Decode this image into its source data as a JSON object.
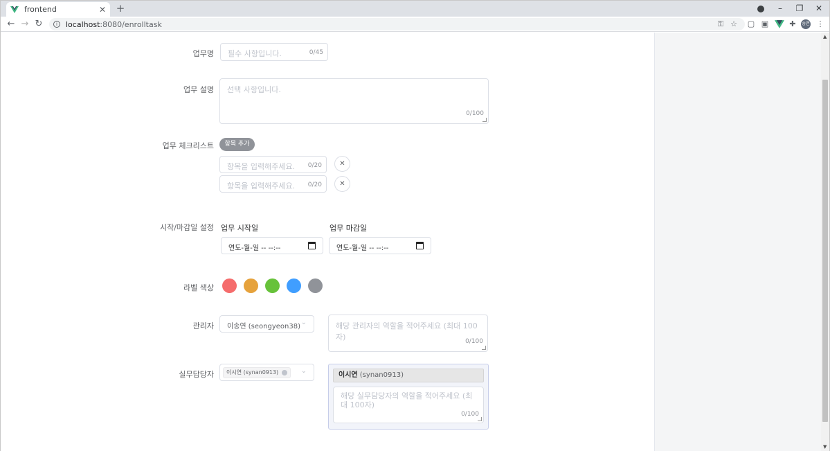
{
  "browser": {
    "tab_title": "frontend",
    "url_host": "localhost",
    "url_rest": ":8080/enrolltask",
    "avatar_text": "송연"
  },
  "form": {
    "task_name": {
      "label": "업무명",
      "placeholder": "필수 사항입니다.",
      "count": "0/45"
    },
    "task_desc": {
      "label": "업무 설명",
      "placeholder": "선택 사항입니다.",
      "count": "0/100"
    },
    "checklist": {
      "label": "업무 체크리스트",
      "add_button": "항목 추가",
      "items": [
        {
          "placeholder": "항목을 입력해주세요.",
          "count": "0/20"
        },
        {
          "placeholder": "항목을 입력해주세요.",
          "count": "0/20"
        }
      ]
    },
    "dates": {
      "label": "시작/마감일 설정",
      "start_label": "업무 시작일",
      "end_label": "업무 마감일",
      "start_value": "연도-월-일 -- --:--",
      "end_value": "연도-월-일 -- --:--"
    },
    "colors": {
      "label": "라벨 색상",
      "swatches": [
        "#f56c6c",
        "#e6a23c",
        "#67c23a",
        "#409eff",
        "#909399"
      ]
    },
    "manager": {
      "label": "관리자",
      "selected": "이송연 (seongyeon38)",
      "role_placeholder": "해당 관리자의 역할을 적어주세요 (최대 100자)",
      "count": "0/100"
    },
    "workers": {
      "label": "실무담당자",
      "tag": "이시연 (synan0913)",
      "card_name": "이시연",
      "card_id": "(synan0913)",
      "role_placeholder": "해당 실무담당자의 역할을 적어주세요 (최대 100자)",
      "count": "0/100"
    }
  }
}
